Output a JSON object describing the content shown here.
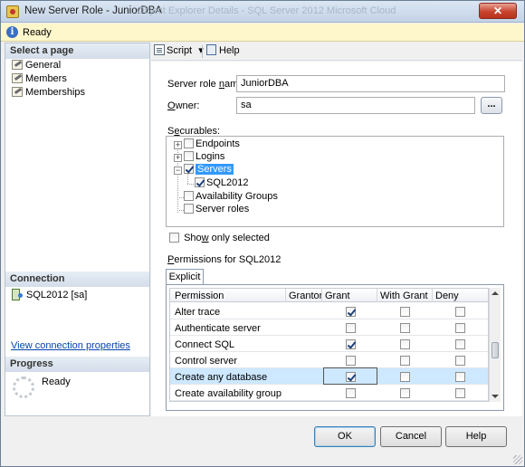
{
  "window": {
    "title": "New Server Role - JuniorDBA",
    "ghost_title": "Object Explorer Details - SQL Server 2012 Microsoft Cloud",
    "close_glyph": "✕"
  },
  "status": {
    "icon_letter": "i",
    "text": "Ready"
  },
  "left_pane": {
    "select_page_header": "Select a page",
    "pages": [
      "General",
      "Members",
      "Memberships"
    ],
    "connection_header": "Connection",
    "connection_server": "SQL2012 [sa]",
    "view_connection_link": "View connection properties",
    "progress_header": "Progress",
    "progress_status": "Ready"
  },
  "toolbar": {
    "script_label": "Script",
    "script_dropdown_glyph": "▾",
    "help_label": "Help"
  },
  "form": {
    "server_role_name_label_pre": "Server role ",
    "server_role_name_label_ul": "n",
    "server_role_name_label_post": "ame:",
    "server_role_name_value": "JuniorDBA",
    "owner_label_ul": "O",
    "owner_label_post": "wner:",
    "owner_value": "sa",
    "browse_label": "...",
    "securables_label_pre": "S",
    "securables_label_ul": "e",
    "securables_label_post": "curables:",
    "show_only_selected_pre": "Sho",
    "show_only_selected_ul": "w",
    "show_only_selected_post": " only selected",
    "permissions_for_label_ul": "P",
    "permissions_for_label_post": "ermissions for SQL2012"
  },
  "securables": {
    "endpoints": "Endpoints",
    "logins": "Logins",
    "servers": "Servers",
    "sql2012": "SQL2012",
    "availability_groups": "Availability Groups",
    "server_roles": "Server roles"
  },
  "permissions": {
    "tab_label": "Explicit",
    "columns": [
      "Permission",
      "Grantor",
      "Grant",
      "With Grant",
      "Deny"
    ],
    "rows": [
      {
        "name": "Alter trace",
        "grant": true,
        "with_grant": false,
        "deny": false
      },
      {
        "name": "Authenticate server",
        "grant": false,
        "with_grant": false,
        "deny": false
      },
      {
        "name": "Connect SQL",
        "grant": true,
        "with_grant": false,
        "deny": false
      },
      {
        "name": "Control server",
        "grant": false,
        "with_grant": false,
        "deny": false
      },
      {
        "name": "Create any database",
        "grant": true,
        "with_grant": false,
        "deny": false,
        "selected": true
      },
      {
        "name": "Create availability group",
        "grant": false,
        "with_grant": false,
        "deny": false
      }
    ]
  },
  "buttons": {
    "ok": "OK",
    "cancel": "Cancel",
    "help": "Help"
  },
  "colors": {
    "selection": "#3399ff",
    "row_highlight": "#cde8ff",
    "status_bg": "#fff7cc"
  }
}
